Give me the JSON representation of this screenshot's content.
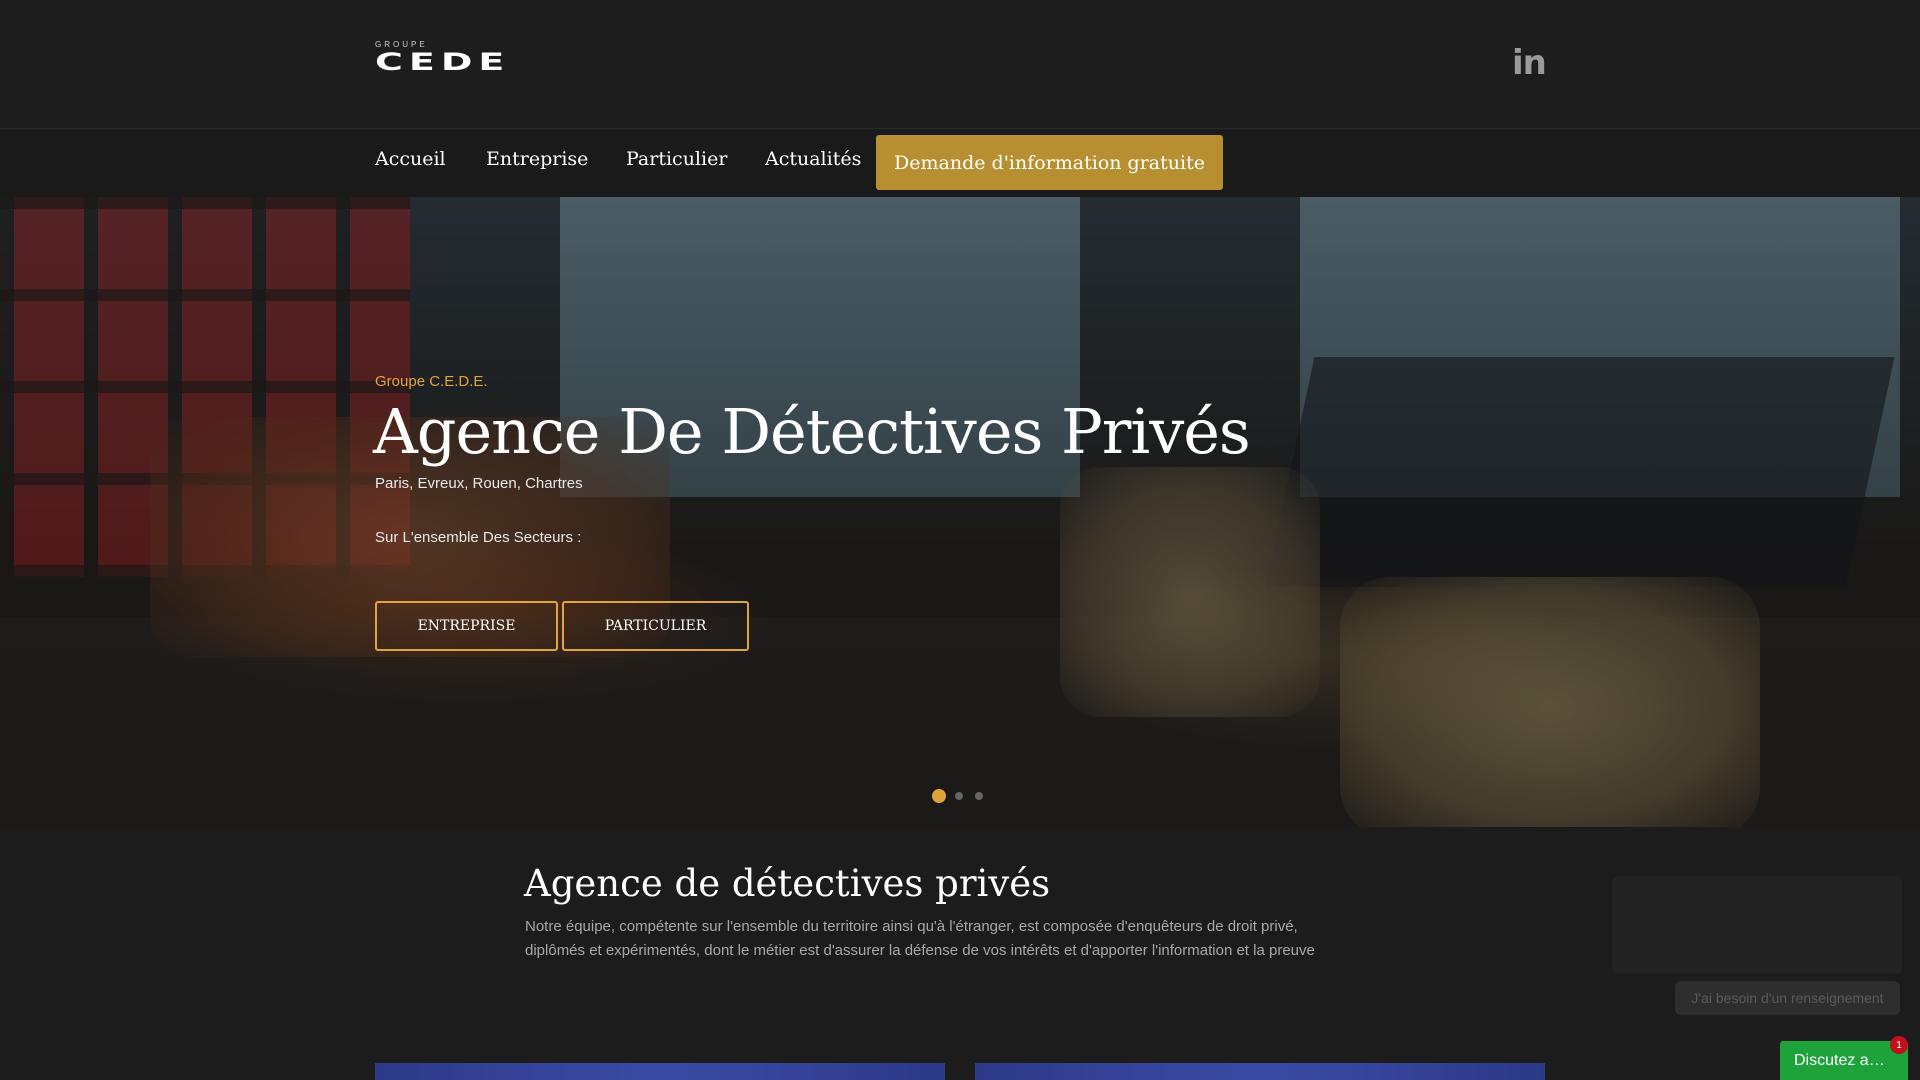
{
  "header": {
    "logo_small": "GROUPE",
    "logo_big": "CEDE",
    "social_icon": "linkedin-icon",
    "social_label": "in"
  },
  "nav": {
    "items": [
      "Accueil",
      "Entreprise",
      "Particulier",
      "Actualités"
    ],
    "cta": "Demande d'information gratuite"
  },
  "hero": {
    "eyebrow": "Groupe C.E.D.E.",
    "title": "Agence De Détectives Privés",
    "subtitle": "Paris, Evreux, Rouen, Chartres",
    "sectors_label": "Sur L'ensemble Des Secteurs :",
    "buttons": [
      "ENTREPRISE",
      "PARTICULIER"
    ],
    "slides_total": 3,
    "slide_active": 1
  },
  "intro": {
    "title": "Agence de détectives privés",
    "text_line1": "Notre équipe, compétente sur l'ensemble du territoire ainsi qu'à l'étranger, est composée d'enquêteurs de droit privé,",
    "text_line2": "diplômés et expérimentés, dont le métier est d'assurer la défense de vos intérêts et d'apporter l'information et la preuve"
  },
  "chat": {
    "suggestion": "J'ai besoin d'un renseignement",
    "launcher_label": "Discutez a…",
    "unread_count": "1"
  },
  "colors": {
    "accent": "#e1a43a",
    "cta": "#b88f30",
    "chat": "#1ea33b",
    "badge": "#c0101a"
  }
}
